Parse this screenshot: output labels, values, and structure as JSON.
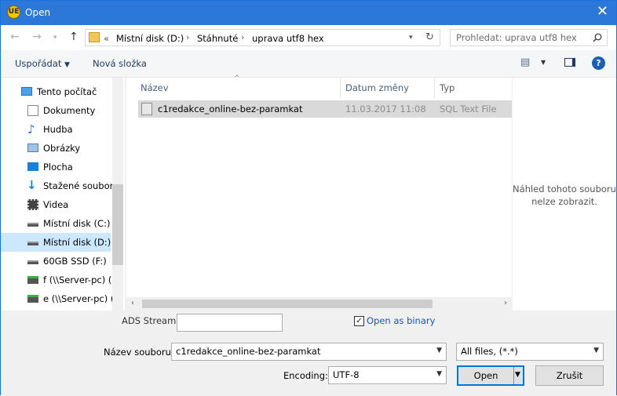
{
  "window": {
    "title": "Open",
    "app_icon": "UE"
  },
  "address": {
    "breadcrumb": [
      "Místní disk (D:)",
      "Stáhnuté",
      "uprava utf8 hex"
    ],
    "prefix": "«"
  },
  "search": {
    "placeholder": "Prohledat: uprava utf8 hex"
  },
  "toolbar": {
    "organize": "Uspořádat",
    "new_folder": "Nová složka"
  },
  "sidebar": {
    "items": [
      {
        "label": "Tento počítač",
        "icon": "computer-icon"
      },
      {
        "label": "Dokumenty",
        "icon": "documents-icon"
      },
      {
        "label": "Hudba",
        "icon": "music-icon"
      },
      {
        "label": "Obrázky",
        "icon": "pictures-icon"
      },
      {
        "label": "Plocha",
        "icon": "desktop-icon"
      },
      {
        "label": "Stažené soubory",
        "icon": "downloads-icon"
      },
      {
        "label": "Videa",
        "icon": "videos-icon"
      },
      {
        "label": "Místní disk (C:)",
        "icon": "drive-icon"
      },
      {
        "label": "Místní disk (D:)",
        "icon": "drive-icon",
        "selected": true
      },
      {
        "label": "60GB SSD (F:)",
        "icon": "drive-icon"
      },
      {
        "label": "f (\\\\Server-pc) (S",
        "icon": "network-drive-icon"
      },
      {
        "label": "e (\\\\Server-pc) (",
        "icon": "network-drive-icon"
      }
    ]
  },
  "columns": {
    "name": "Název",
    "date": "Datum změny",
    "type": "Typ"
  },
  "files": [
    {
      "name": "c1redakce_online-bez-paramkat",
      "date": "11.03.2017 11:08",
      "type": "SQL Text File"
    }
  ],
  "preview": {
    "line1": "Náhled tohoto souboru",
    "line2": "nelze zobrazit."
  },
  "ads_stream": {
    "label": "ADS Stream:",
    "value": ""
  },
  "open_as_binary": {
    "label": "Open as binary",
    "checked": true
  },
  "filename": {
    "label": "Název souboru:",
    "value": "c1redakce_online-bez-paramkat"
  },
  "filter": {
    "value": "All files, (*.*)"
  },
  "encoding": {
    "label": "Encoding:",
    "value": "UTF-8"
  },
  "buttons": {
    "open": "Open",
    "cancel": "Zrušit"
  }
}
